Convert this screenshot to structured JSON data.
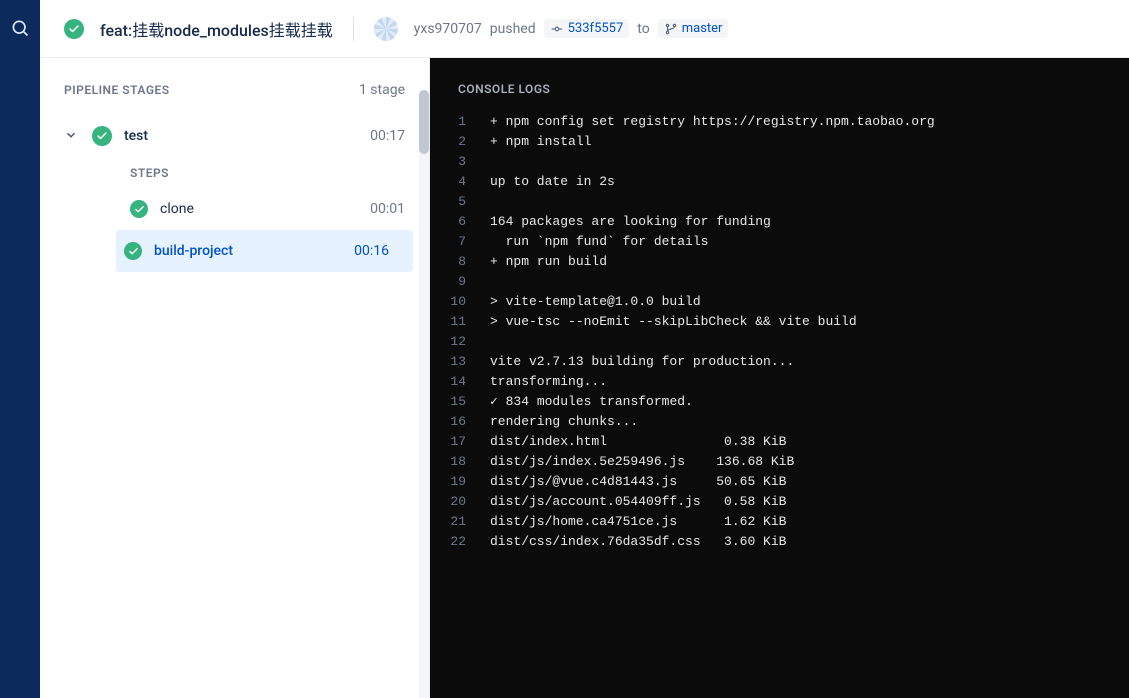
{
  "header": {
    "commit_title": "feat:挂载node_modules挂载挂载",
    "author": "yxs970707",
    "action": "pushed",
    "commit_hash": "533f5557",
    "to_label": "to",
    "branch": "master"
  },
  "pipeline": {
    "title": "PIPELINE STAGES",
    "stage_count": "1 stage",
    "steps_label": "STEPS",
    "stage": {
      "name": "test",
      "duration": "00:17",
      "steps": [
        {
          "name": "clone",
          "duration": "00:01",
          "selected": false
        },
        {
          "name": "build-project",
          "duration": "00:16",
          "selected": true
        }
      ]
    }
  },
  "console": {
    "title": "CONSOLE LOGS",
    "lines": [
      "+ npm config set registry https://registry.npm.taobao.org",
      "+ npm install",
      "",
      "up to date in 2s",
      "",
      "164 packages are looking for funding",
      "  run `npm fund` for details",
      "+ npm run build",
      "",
      "> vite-template@1.0.0 build",
      "> vue-tsc --noEmit --skipLibCheck && vite build",
      "",
      "vite v2.7.13 building for production...",
      "transforming...",
      "✓ 834 modules transformed.",
      "rendering chunks...",
      "dist/index.html               0.38 KiB",
      "dist/js/index.5e259496.js    136.68 KiB",
      "dist/js/@vue.c4d81443.js     50.65 KiB",
      "dist/js/account.054409ff.js   0.58 KiB",
      "dist/js/home.ca4751ce.js      1.62 KiB",
      "dist/css/index.76da35df.css   3.60 KiB"
    ]
  }
}
